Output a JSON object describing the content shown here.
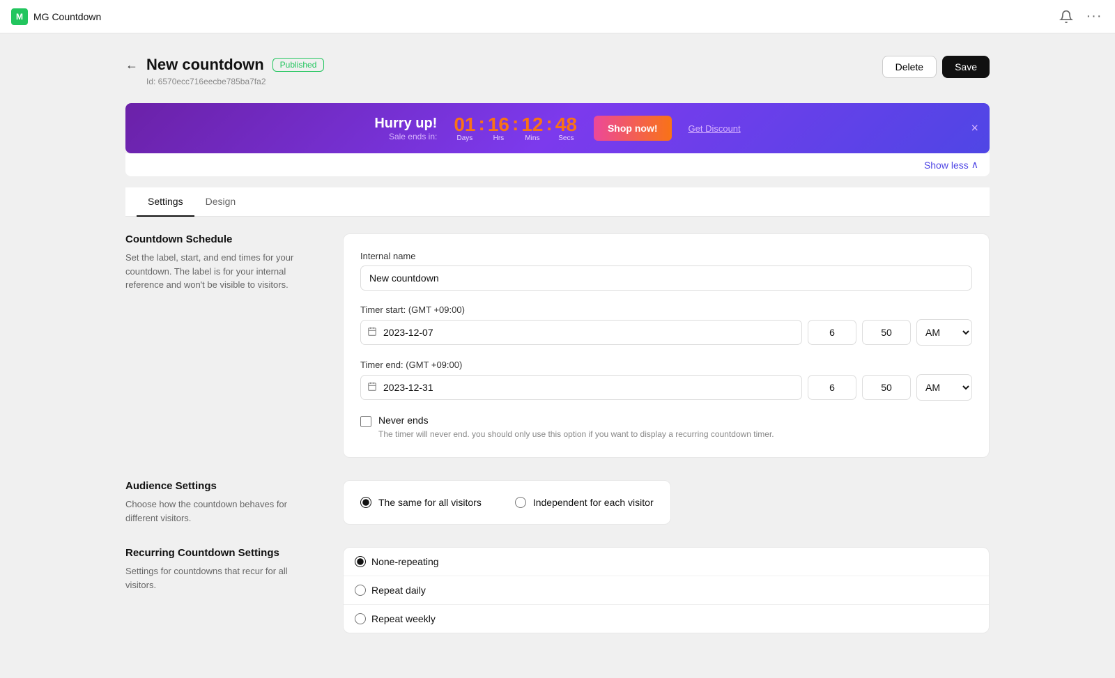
{
  "app": {
    "name": "MG Countdown",
    "icon_letter": "M"
  },
  "topbar": {
    "bell_icon": "🔔",
    "more_icon": "···"
  },
  "header": {
    "title": "New countdown",
    "status": "Published",
    "id_label": "Id: 6570ecc716eecbe785ba7fa2",
    "back_icon": "←",
    "delete_label": "Delete",
    "save_label": "Save"
  },
  "preview": {
    "hurry_up": "Hurry up!",
    "sale_ends_in": "Sale ends in:",
    "days_val": "01",
    "hrs_val": "16",
    "mins_val": "12",
    "secs_val": "48",
    "days_label": "Days",
    "hrs_label": "Hrs",
    "mins_label": "Mins",
    "secs_label": "Secs",
    "shop_btn": "Shop now!",
    "get_discount": "Get Discount",
    "close_icon": "×",
    "show_less": "Show less",
    "chevron_up": "∧"
  },
  "tabs": [
    {
      "label": "Settings",
      "active": true
    },
    {
      "label": "Design",
      "active": false
    }
  ],
  "countdown_schedule": {
    "section_title": "Countdown Schedule",
    "section_desc": "Set the label, start, and end times for your countdown. The label is for your internal reference and won't be visible to visitors.",
    "internal_name_label": "Internal name",
    "internal_name_value": "New countdown",
    "timer_start_label": "Timer start: (GMT +09:00)",
    "timer_start_date": "2023-12-07",
    "timer_start_hour": "6",
    "timer_start_min": "50",
    "timer_start_ampm": "AM",
    "timer_end_label": "Timer end: (GMT +09:00)",
    "timer_end_date": "2023-12-31",
    "timer_end_hour": "6",
    "timer_end_min": "50",
    "timer_end_ampm": "AM",
    "never_ends_label": "Never ends",
    "never_ends_desc": "The timer will never end. you should only use this option if you want to display a recurring countdown timer."
  },
  "audience_settings": {
    "section_title": "Audience Settings",
    "section_desc": "Choose how the countdown behaves for different visitors.",
    "option_all": "The same for all visitors",
    "option_independent": "Independent for each visitor"
  },
  "recurring_settings": {
    "section_title": "Recurring Countdown Settings",
    "section_desc": "Settings for countdowns that recur for all visitors.",
    "option_none": "None-repeating",
    "option_daily": "Repeat daily",
    "option_weekly": "Repeat weekly"
  }
}
